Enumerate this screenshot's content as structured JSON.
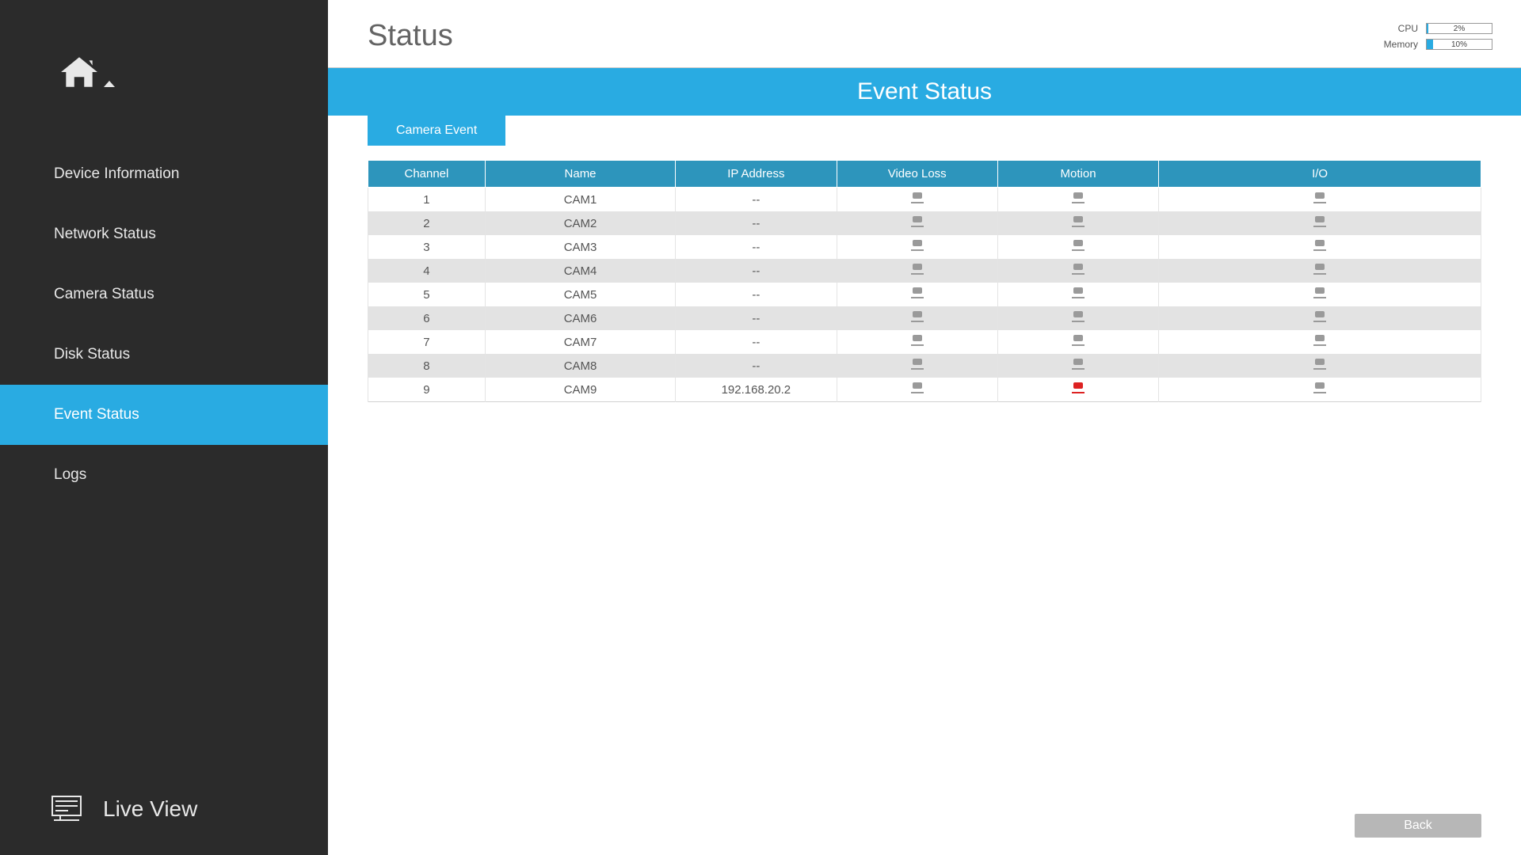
{
  "sidebar": {
    "items": [
      {
        "label": "Device Information",
        "active": false
      },
      {
        "label": "Network Status",
        "active": false
      },
      {
        "label": "Camera Status",
        "active": false
      },
      {
        "label": "Disk Status",
        "active": false
      },
      {
        "label": "Event Status",
        "active": true
      },
      {
        "label": "Logs",
        "active": false
      }
    ],
    "liveview_label": "Live View"
  },
  "header": {
    "title": "Status",
    "cpu_label": "CPU",
    "cpu_pct": "2%",
    "cpu_fill": 2,
    "mem_label": "Memory",
    "mem_pct": "10%",
    "mem_fill": 10
  },
  "section": {
    "banner": "Event Status"
  },
  "tabs": [
    {
      "label": "Camera Event",
      "active": true
    }
  ],
  "table": {
    "columns": [
      "Channel",
      "Name",
      "IP Address",
      "Video Loss",
      "Motion",
      "I/O"
    ],
    "rows": [
      {
        "channel": "1",
        "name": "CAM1",
        "ip": "--",
        "vl": "normal",
        "motion": "normal",
        "io": "normal"
      },
      {
        "channel": "2",
        "name": "CAM2",
        "ip": "--",
        "vl": "normal",
        "motion": "normal",
        "io": "normal"
      },
      {
        "channel": "3",
        "name": "CAM3",
        "ip": "--",
        "vl": "normal",
        "motion": "normal",
        "io": "normal"
      },
      {
        "channel": "4",
        "name": "CAM4",
        "ip": "--",
        "vl": "normal",
        "motion": "normal",
        "io": "normal"
      },
      {
        "channel": "5",
        "name": "CAM5",
        "ip": "--",
        "vl": "normal",
        "motion": "normal",
        "io": "normal"
      },
      {
        "channel": "6",
        "name": "CAM6",
        "ip": "--",
        "vl": "normal",
        "motion": "normal",
        "io": "normal"
      },
      {
        "channel": "7",
        "name": "CAM7",
        "ip": "--",
        "vl": "normal",
        "motion": "normal",
        "io": "normal"
      },
      {
        "channel": "8",
        "name": "CAM8",
        "ip": "--",
        "vl": "normal",
        "motion": "normal",
        "io": "normal"
      },
      {
        "channel": "9",
        "name": "CAM9",
        "ip": "192.168.20.2",
        "vl": "normal",
        "motion": "alert",
        "io": "normal"
      }
    ]
  },
  "buttons": {
    "back": "Back"
  }
}
